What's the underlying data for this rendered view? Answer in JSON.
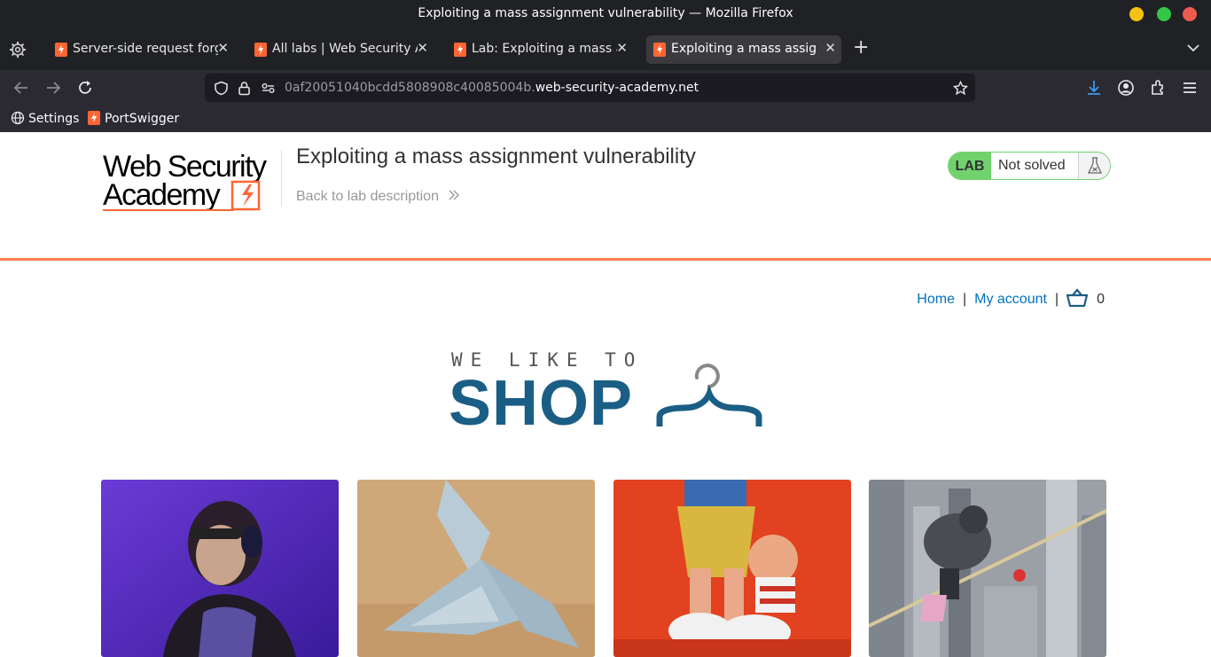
{
  "browser": {
    "window_title": "Exploiting a mass assignment vulnerability — Mozilla Firefox",
    "tabs": [
      {
        "label": "Server-side request forge",
        "active": false
      },
      {
        "label": "All labs | Web Security Academy",
        "active": false
      },
      {
        "label": "Lab: Exploiting a mass assignment",
        "active": false
      },
      {
        "label": "Exploiting a mass assignment vulnerability",
        "active": true
      }
    ],
    "url_prefix": "0af20051040bcdd5808908c40085004b.",
    "url_domain": "web-security-academy.net",
    "bookmarks": [
      {
        "label": "Settings",
        "icon": "globe-icon"
      },
      {
        "label": "PortSwigger",
        "icon": "portswigger-icon"
      }
    ]
  },
  "header": {
    "logo_line1": "Web Security",
    "logo_line2": "Academy",
    "lab_title": "Exploiting a mass assignment vulnerability",
    "back_link": "Back to lab description",
    "lab_badge": "LAB",
    "lab_status": "Not solved"
  },
  "nav": {
    "home": "Home",
    "separator": "|",
    "my_account": "My account",
    "cart_count": "0"
  },
  "banner": {
    "small_text": "WE LIKE TO",
    "big_text": "SHOP"
  },
  "products": [
    {
      "image": "woman-headphones-purple"
    },
    {
      "image": "origami-banknote-bird"
    },
    {
      "image": "toy-figures-red-background"
    },
    {
      "image": "child-tightrope-city"
    }
  ],
  "colors": {
    "accent_orange": "#ff6633",
    "link_blue": "#0071bc",
    "lab_green": "#70d16d",
    "shop_blue": "#1b5e85"
  }
}
